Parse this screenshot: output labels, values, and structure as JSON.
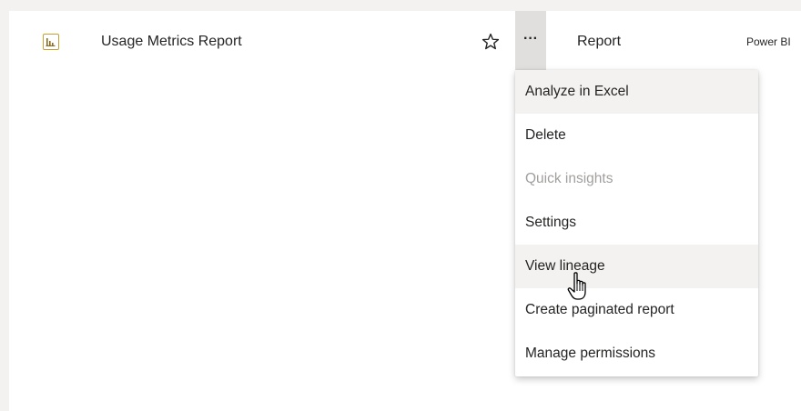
{
  "row": {
    "icon": "report-chart-icon",
    "name": "Usage Metrics Report",
    "favorite_icon": "star-outline-icon",
    "more_label": "···",
    "type": "Report",
    "owner": "Power BI"
  },
  "context_menu": {
    "items": [
      {
        "label": "Analyze in Excel",
        "state": "hover"
      },
      {
        "label": "Delete",
        "state": "normal"
      },
      {
        "label": "Quick insights",
        "state": "disabled"
      },
      {
        "label": "Settings",
        "state": "normal"
      },
      {
        "label": "View lineage",
        "state": "hover"
      },
      {
        "label": "Create paginated report",
        "state": "normal"
      },
      {
        "label": "Manage permissions",
        "state": "normal"
      }
    ]
  },
  "pointer": {
    "icon": "hand-pointer-icon"
  },
  "colors": {
    "icon_accent": "#c8a032",
    "more_button_bg": "#e1dfdd",
    "menu_hover_bg": "#f3f2f1",
    "disabled_text": "#a19f9d",
    "text": "#252423"
  }
}
